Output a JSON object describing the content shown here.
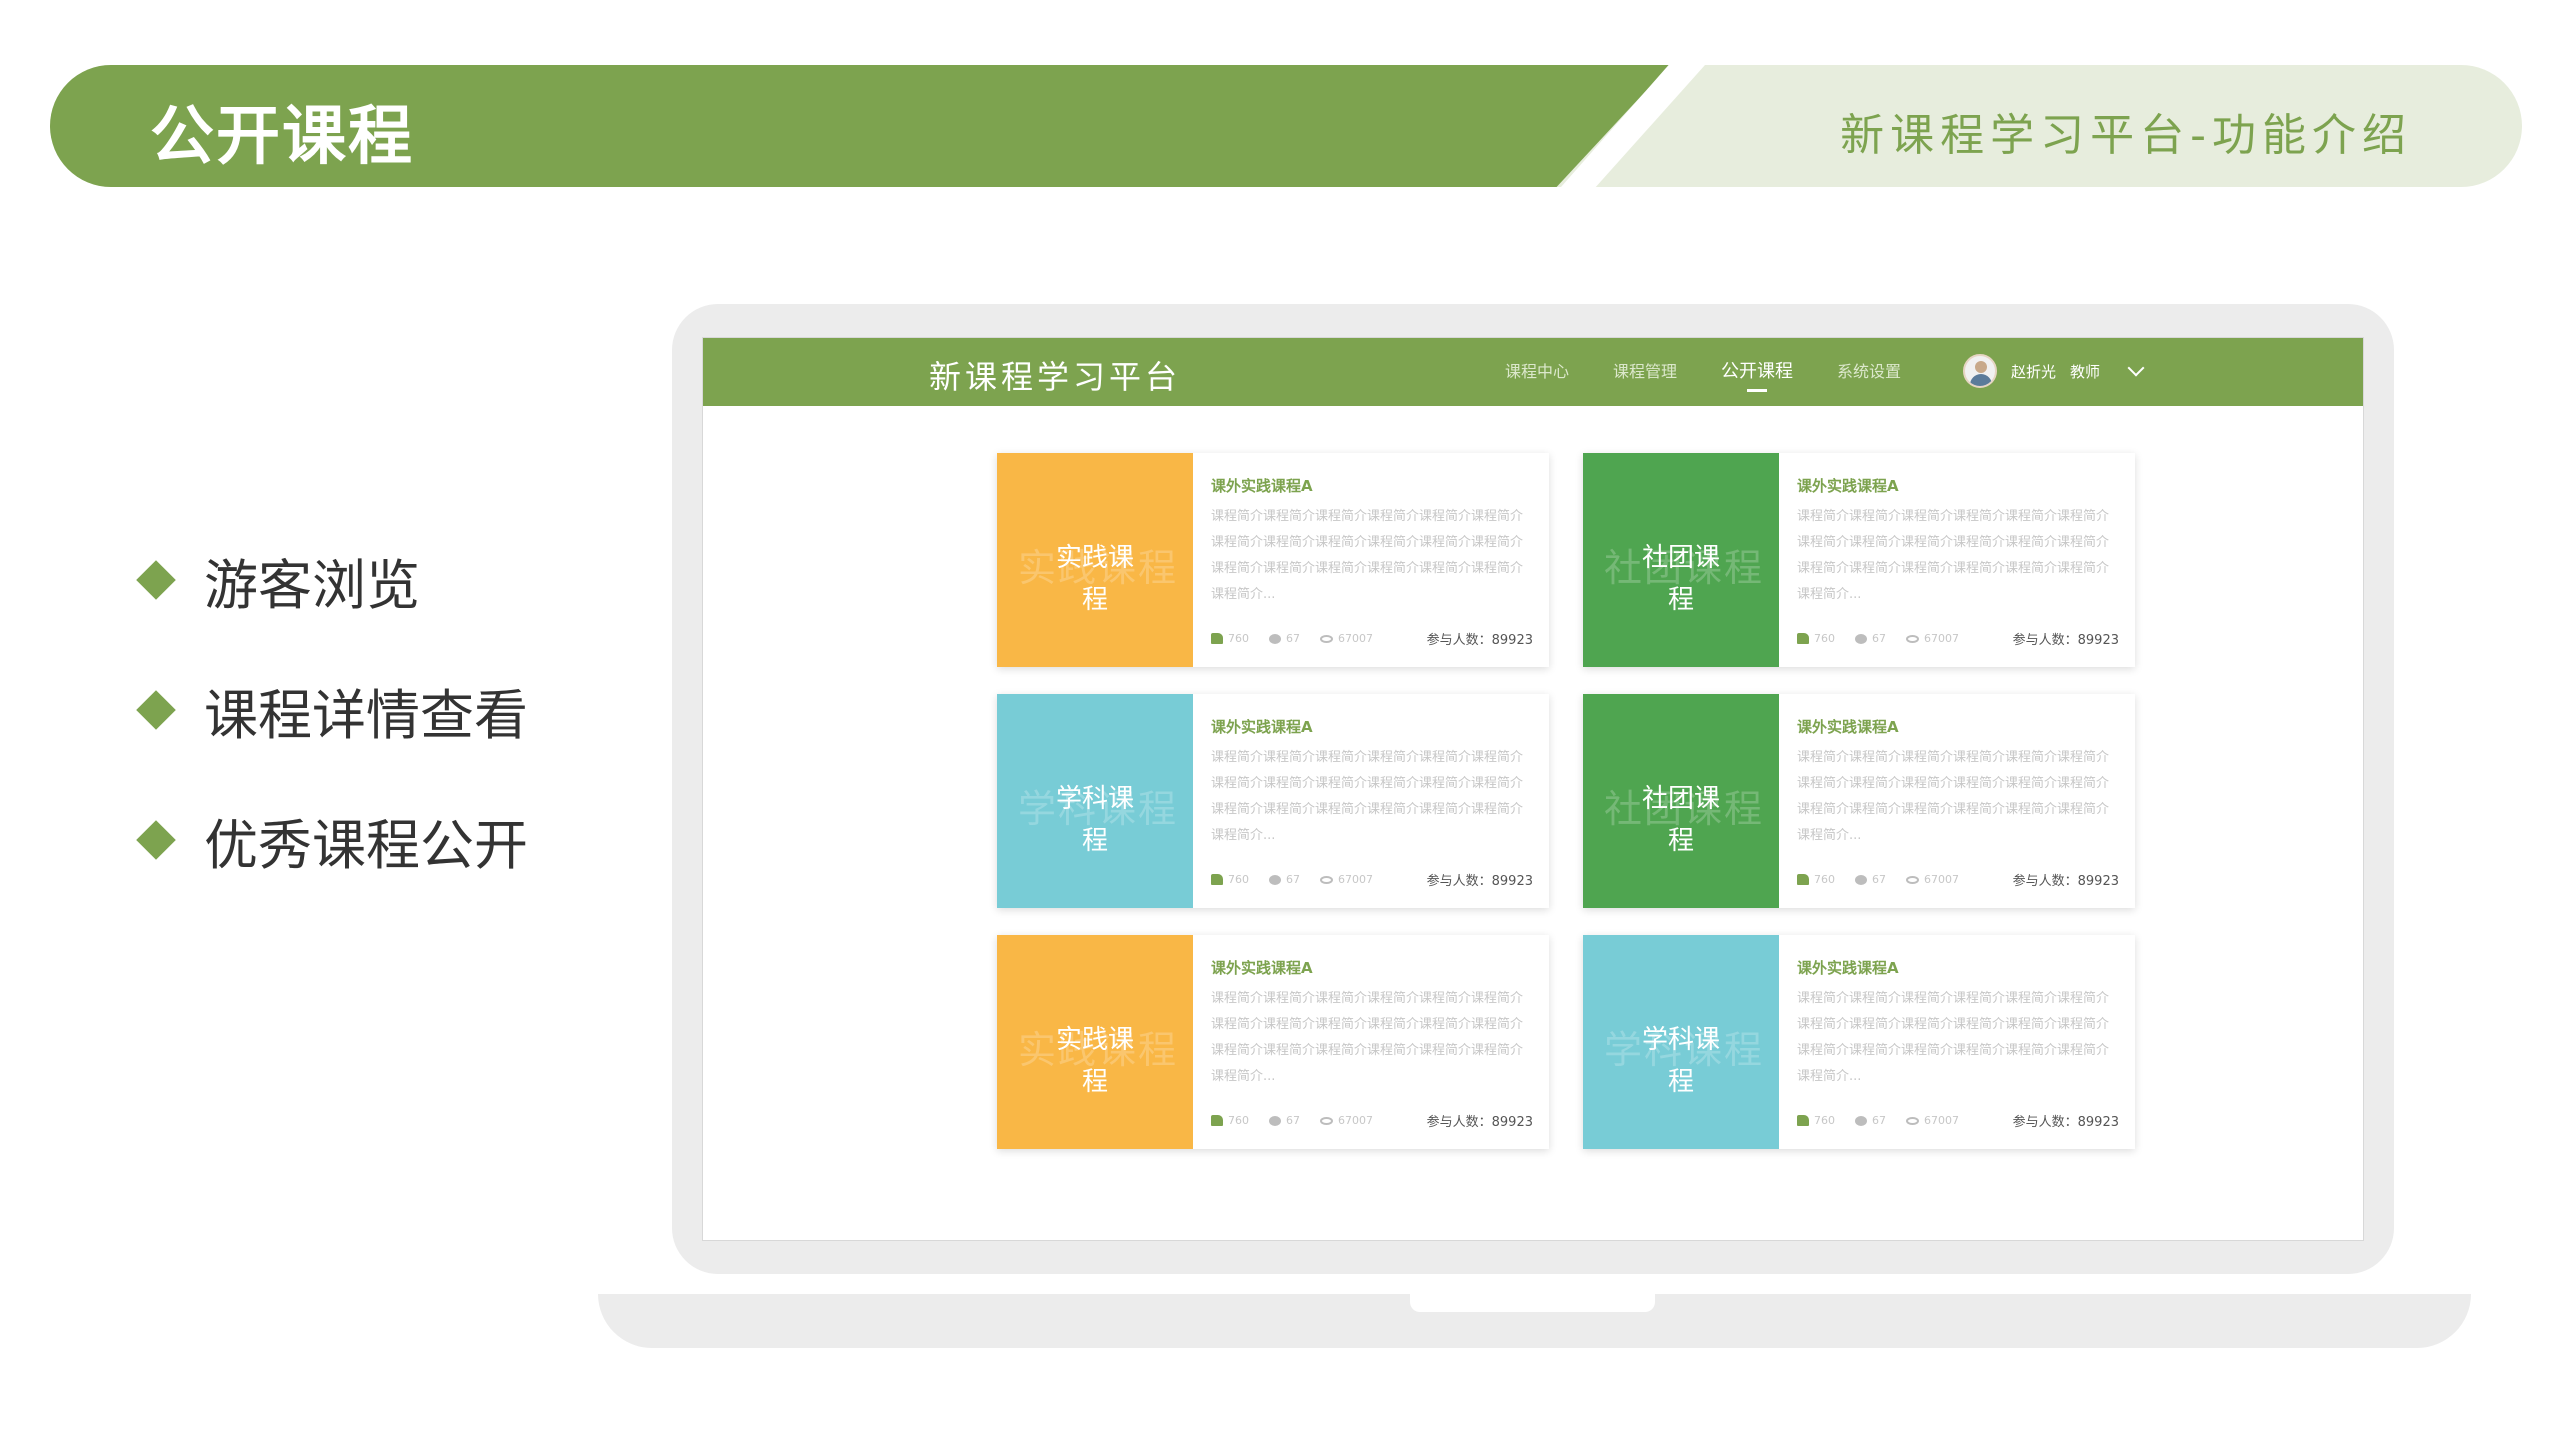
{
  "banner": {
    "title": "公开课程",
    "subtitle": "新课程学习平台-功能介绍"
  },
  "features": [
    "游客浏览",
    "课程详情查看",
    "优秀课程公开"
  ],
  "app": {
    "logo": "新课程学习平台",
    "nav": [
      "课程中心",
      "课程管理",
      "公开课程",
      "系统设置"
    ],
    "active_nav": "公开课程",
    "user": {
      "name": "赵折光",
      "role": "教师"
    }
  },
  "courses": [
    {
      "category": "实践课程",
      "category_l1": "实践课",
      "category_l2": "程",
      "color": "#f9b746",
      "title": "课外实践课程A",
      "desc": "课程简介课程简介课程简介课程简介课程简介课程简介课程简介课程简介课程简介课程简介课程简介课程简介课程简介课程简介课程简介课程简介课程简介课程简介课程简介...",
      "likes": "760",
      "comments": "67",
      "views": "67007",
      "participants": "参与人数：89923"
    },
    {
      "category": "社团课程",
      "category_l1": "社团课",
      "category_l2": "程",
      "color": "#4fa550",
      "title": "课外实践课程A",
      "desc": "课程简介课程简介课程简介课程简介课程简介课程简介课程简介课程简介课程简介课程简介课程简介课程简介课程简介课程简介课程简介课程简介课程简介课程简介课程简介...",
      "likes": "760",
      "comments": "67",
      "views": "67007",
      "participants": "参与人数：89923"
    },
    {
      "category": "学科课程",
      "category_l1": "学科课",
      "category_l2": "程",
      "color": "#78ccd6",
      "title": "课外实践课程A",
      "desc": "课程简介课程简介课程简介课程简介课程简介课程简介课程简介课程简介课程简介课程简介课程简介课程简介课程简介课程简介课程简介课程简介课程简介课程简介课程简介...",
      "likes": "760",
      "comments": "67",
      "views": "67007",
      "participants": "参与人数：89923"
    },
    {
      "category": "社团课程",
      "category_l1": "社团课",
      "category_l2": "程",
      "color": "#4fa550",
      "title": "课外实践课程A",
      "desc": "课程简介课程简介课程简介课程简介课程简介课程简介课程简介课程简介课程简介课程简介课程简介课程简介课程简介课程简介课程简介课程简介课程简介课程简介课程简介...",
      "likes": "760",
      "comments": "67",
      "views": "67007",
      "participants": "参与人数：89923"
    },
    {
      "category": "实践课程",
      "category_l1": "实践课",
      "category_l2": "程",
      "color": "#f9b746",
      "title": "课外实践课程A",
      "desc": "课程简介课程简介课程简介课程简介课程简介课程简介课程简介课程简介课程简介课程简介课程简介课程简介课程简介课程简介课程简介课程简介课程简介课程简介课程简介...",
      "likes": "760",
      "comments": "67",
      "views": "67007",
      "participants": "参与人数：89923"
    },
    {
      "category": "学科课程",
      "category_l1": "学科课",
      "category_l2": "程",
      "color": "#78ccd6",
      "title": "课外实践课程A",
      "desc": "课程简介课程简介课程简介课程简介课程简介课程简介课程简介课程简介课程简介课程简介课程简介课程简介课程简介课程简介课程简介课程简介课程简介课程简介课程简介...",
      "likes": "760",
      "comments": "67",
      "views": "67007",
      "participants": "参与人数：89923"
    }
  ]
}
